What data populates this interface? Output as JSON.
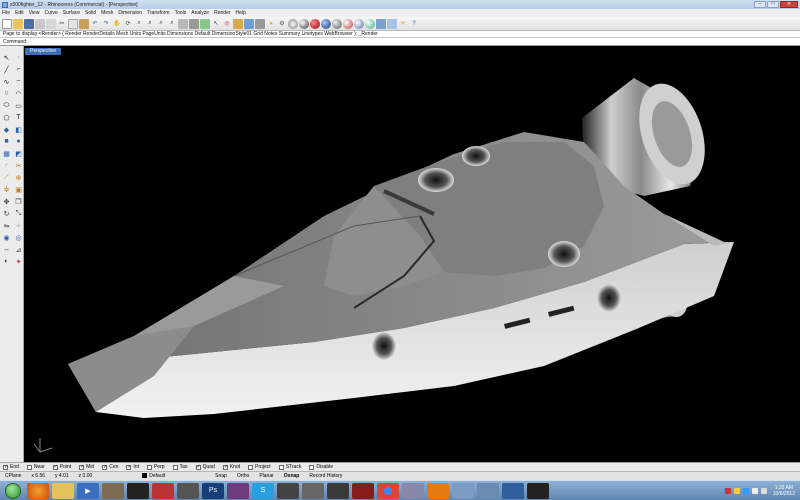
{
  "window": {
    "title": "x500fighter_12 - Rhinoceros (Commercial) - [Perspective]"
  },
  "menu": [
    "File",
    "Edit",
    "View",
    "Curve",
    "Surface",
    "Solid",
    "Mesh",
    "Dimension",
    "Transform",
    "Tools",
    "Analyze",
    "Render",
    "Help"
  ],
  "command_history": "Page to display <Render> ( Render RenderDetails Mesh Units PageUnits Dimensions Default DimensionStyle01 Grid Notes Summary Linetypes WebBrowser ): _Render",
  "command_prompt": "Command:",
  "viewport": {
    "tab_label": "Perspective"
  },
  "osnaps": [
    {
      "label": "End",
      "checked": true
    },
    {
      "label": "Near",
      "checked": false
    },
    {
      "label": "Point",
      "checked": true
    },
    {
      "label": "Mid",
      "checked": true
    },
    {
      "label": "Cen",
      "checked": true
    },
    {
      "label": "Int",
      "checked": true
    },
    {
      "label": "Perp",
      "checked": false
    },
    {
      "label": "Tan",
      "checked": false
    },
    {
      "label": "Quad",
      "checked": true
    },
    {
      "label": "Knot",
      "checked": true
    },
    {
      "label": "Project",
      "checked": false
    },
    {
      "label": "STrack",
      "checked": false
    },
    {
      "label": "Disable",
      "checked": false
    }
  ],
  "status": {
    "cplane": "CPlane",
    "x": "x 6.56",
    "y": "y 4.01",
    "z": "z 0.00",
    "layer": "Default",
    "snap": "Snap",
    "ortho": "Ortho",
    "planar": "Planar",
    "osnap": "Osnap",
    "record_history": "Record History"
  },
  "taskbar": {
    "time": "1:33 AM",
    "date": "10/6/2012"
  },
  "colors": {
    "accent": "#3b6fb5",
    "viewport_bg": "#000000",
    "model_grey": "#a8a8a8"
  }
}
